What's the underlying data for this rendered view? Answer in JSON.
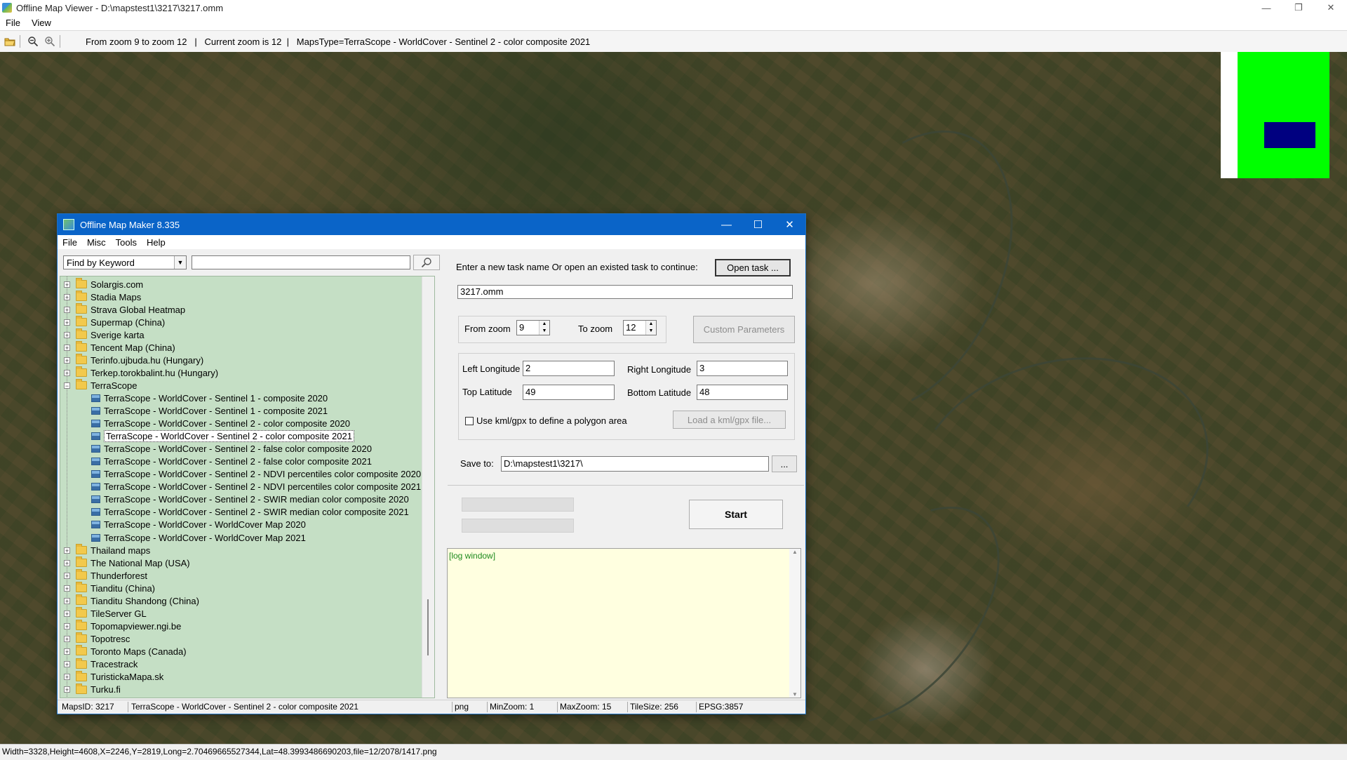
{
  "window": {
    "title": "Offline Map Viewer - D:\\mapstest1\\3217\\3217.omm",
    "menu": [
      "File",
      "View"
    ],
    "controls": [
      "—",
      "❐",
      "✕"
    ]
  },
  "toolbar": {
    "info": "From zoom 9 to zoom 12   |   Current zoom is 12  |   MapsType=TerraScope - WorldCover - Sentinel 2 - color composite 2021"
  },
  "status_bar": "Width=3328,Height=4608,X=2246,Y=2819,Long=2.70469665527344,Lat=48.3993486690203,file=12/2078/1417.png",
  "dialog": {
    "title": "Offline Map Maker 8.335",
    "controls": [
      "—",
      "☐",
      "✕"
    ],
    "menu": [
      "File",
      "Misc",
      "Tools",
      "Help"
    ],
    "find_mode": "Find by Keyword",
    "search_value": "",
    "tree": [
      {
        "label": "Solargis.com",
        "level": 0,
        "kind": "folder",
        "expander": "+"
      },
      {
        "label": "Stadia Maps",
        "level": 0,
        "kind": "folder",
        "expander": "+"
      },
      {
        "label": "Strava Global Heatmap",
        "level": 0,
        "kind": "folder",
        "expander": "+"
      },
      {
        "label": "Supermap (China)",
        "level": 0,
        "kind": "folder",
        "expander": "+"
      },
      {
        "label": "Sverige karta",
        "level": 0,
        "kind": "folder",
        "expander": "+"
      },
      {
        "label": "Tencent Map (China)",
        "level": 0,
        "kind": "folder",
        "expander": "+"
      },
      {
        "label": "Terinfo.ujbuda.hu (Hungary)",
        "level": 0,
        "kind": "folder",
        "expander": "+"
      },
      {
        "label": "Terkep.torokbalint.hu (Hungary)",
        "level": 0,
        "kind": "folder",
        "expander": "+"
      },
      {
        "label": "TerraScope",
        "level": 0,
        "kind": "folder-open",
        "expander": "−"
      },
      {
        "label": "TerraScope - WorldCover - Sentinel 1 - composite 2020",
        "level": 1,
        "kind": "map"
      },
      {
        "label": "TerraScope - WorldCover - Sentinel 1 - composite 2021",
        "level": 1,
        "kind": "map"
      },
      {
        "label": "TerraScope - WorldCover - Sentinel 2 - color composite 2020",
        "level": 1,
        "kind": "map"
      },
      {
        "label": "TerraScope - WorldCover - Sentinel 2 - color composite 2021",
        "level": 1,
        "kind": "map",
        "selected": true
      },
      {
        "label": "TerraScope - WorldCover - Sentinel 2 - false color composite 2020",
        "level": 1,
        "kind": "map"
      },
      {
        "label": "TerraScope - WorldCover - Sentinel 2 - false color composite 2021",
        "level": 1,
        "kind": "map"
      },
      {
        "label": "TerraScope - WorldCover - Sentinel 2 - NDVI percentiles color composite 2020",
        "level": 1,
        "kind": "map"
      },
      {
        "label": "TerraScope - WorldCover - Sentinel 2 - NDVI percentiles color composite 2021",
        "level": 1,
        "kind": "map"
      },
      {
        "label": "TerraScope - WorldCover - Sentinel 2 - SWIR median color composite 2020",
        "level": 1,
        "kind": "map"
      },
      {
        "label": "TerraScope - WorldCover - Sentinel 2 - SWIR median color composite 2021",
        "level": 1,
        "kind": "map"
      },
      {
        "label": "TerraScope - WorldCover - WorldCover Map 2020",
        "level": 1,
        "kind": "map"
      },
      {
        "label": "TerraScope - WorldCover - WorldCover Map 2021",
        "level": 1,
        "kind": "map"
      },
      {
        "label": "Thailand maps",
        "level": 0,
        "kind": "folder",
        "expander": "+"
      },
      {
        "label": "The National Map (USA)",
        "level": 0,
        "kind": "folder",
        "expander": "+"
      },
      {
        "label": "Thunderforest",
        "level": 0,
        "kind": "folder",
        "expander": "+"
      },
      {
        "label": "Tianditu (China)",
        "level": 0,
        "kind": "folder",
        "expander": "+"
      },
      {
        "label": "Tianditu Shandong (China)",
        "level": 0,
        "kind": "folder",
        "expander": "+"
      },
      {
        "label": "TileServer GL",
        "level": 0,
        "kind": "folder",
        "expander": "+"
      },
      {
        "label": "Topomapviewer.ngi.be",
        "level": 0,
        "kind": "folder",
        "expander": "+"
      },
      {
        "label": "Topotresc",
        "level": 0,
        "kind": "folder",
        "expander": "+"
      },
      {
        "label": "Toronto Maps (Canada)",
        "level": 0,
        "kind": "folder",
        "expander": "+"
      },
      {
        "label": "Tracestrack",
        "level": 0,
        "kind": "folder",
        "expander": "+"
      },
      {
        "label": "TuristickaMapa.sk",
        "level": 0,
        "kind": "folder",
        "expander": "+"
      },
      {
        "label": "Turku.fi",
        "level": 0,
        "kind": "folder",
        "expander": "+"
      }
    ],
    "task_prompt": "Enter a new task name Or open an existed task to continue:",
    "open_task_label": "Open task ...",
    "task_name": "3217.omm",
    "from_zoom_label": "From zoom",
    "from_zoom": "9",
    "to_zoom_label": "To zoom",
    "to_zoom": "12",
    "custom_params_label": "Custom Parameters",
    "left_lon_label": "Left Longitude",
    "left_lon": "2",
    "right_lon_label": "Right Longitude",
    "right_lon": "3",
    "top_lat_label": "Top Latitude",
    "top_lat": "49",
    "bottom_lat_label": "Bottom Latitude",
    "bottom_lat": "48",
    "polygon_label": "Use kml/gpx to define a polygon area",
    "load_kml_label": "Load a kml/gpx file...",
    "save_to_label": "Save to:",
    "save_to": "D:\\mapstest1\\3217\\",
    "browse_label": "...",
    "start_label": "Start",
    "log_text": "[log window]",
    "status": {
      "maps_id": "MapsID: 3217",
      "map_name": "TerraScope - WorldCover - Sentinel 2 - color composite 2021",
      "format": "png",
      "min_zoom": "MinZoom: 1",
      "max_zoom": "MaxZoom: 15",
      "tile_size": "TileSize: 256",
      "epsg": "EPSG:3857"
    }
  },
  "colors": {
    "dialog_title": "#0a64c8",
    "tree_bg": "#c5dfc5",
    "log_bg": "#ffffe0",
    "minimap_green": "#00ff00",
    "minimap_blue": "#000080"
  }
}
